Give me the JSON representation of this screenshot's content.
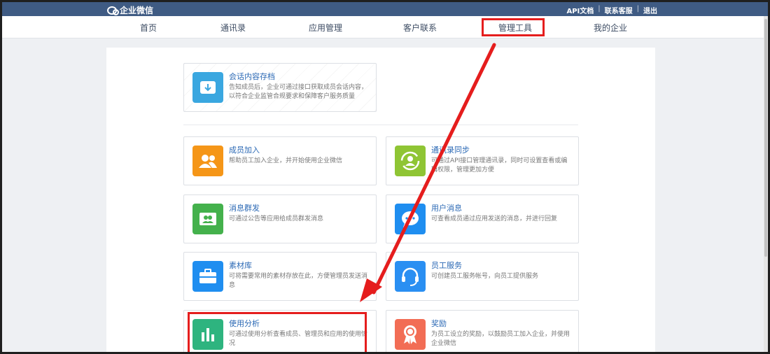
{
  "topbar": {
    "logo": "企业微信",
    "links": [
      "API文档",
      "联系客服",
      "退出"
    ]
  },
  "nav": {
    "items": [
      "首页",
      "通讯录",
      "应用管理",
      "客户联系",
      "管理工具",
      "我的企业"
    ],
    "active": "管理工具"
  },
  "cards": {
    "archive": {
      "title": "会话内容存档",
      "desc": "告知成员后，企业可通过接口获取成员会话内容，以符合企业监管合规要求和保障客户服务质量"
    },
    "join": {
      "title": "成员加入",
      "desc": "帮助员工加入企业，并开始使用企业微信"
    },
    "sync": {
      "title": "通讯录同步",
      "desc": "可通过API接口管理通讯录，同时可设置查看或编辑权限，管理更加方便"
    },
    "broadcast": {
      "title": "消息群发",
      "desc": "可通过公告等应用给成员群发消息"
    },
    "user_msg": {
      "title": "用户消息",
      "desc": "可查看成员通过应用发送的消息，并进行回复"
    },
    "material": {
      "title": "素材库",
      "desc": "可将需要常用的素材存放在此，方便管理员发送消息"
    },
    "staff_service": {
      "title": "员工服务",
      "desc": "可创建员工服务帐号，向员工提供服务"
    },
    "analytics": {
      "title": "使用分析",
      "desc": "可通过使用分析查看成员、管理员和应用的使用情况"
    },
    "reward": {
      "title": "奖励",
      "desc": "为员工设立的奖励，以鼓励员工加入企业，并使用企业微信"
    }
  },
  "colors": {
    "archive": "#3aa7e0",
    "join": "#f59618",
    "sync": "#8fc534",
    "broadcast": "#44b14c",
    "user_msg": "#1f8ef0",
    "material": "#1f8ef0",
    "staff_service": "#2a8ff2",
    "analytics": "#2eb47f",
    "reward": "#f26d55",
    "highlight": "#e51d1d",
    "topbar": "#3f5b83"
  }
}
